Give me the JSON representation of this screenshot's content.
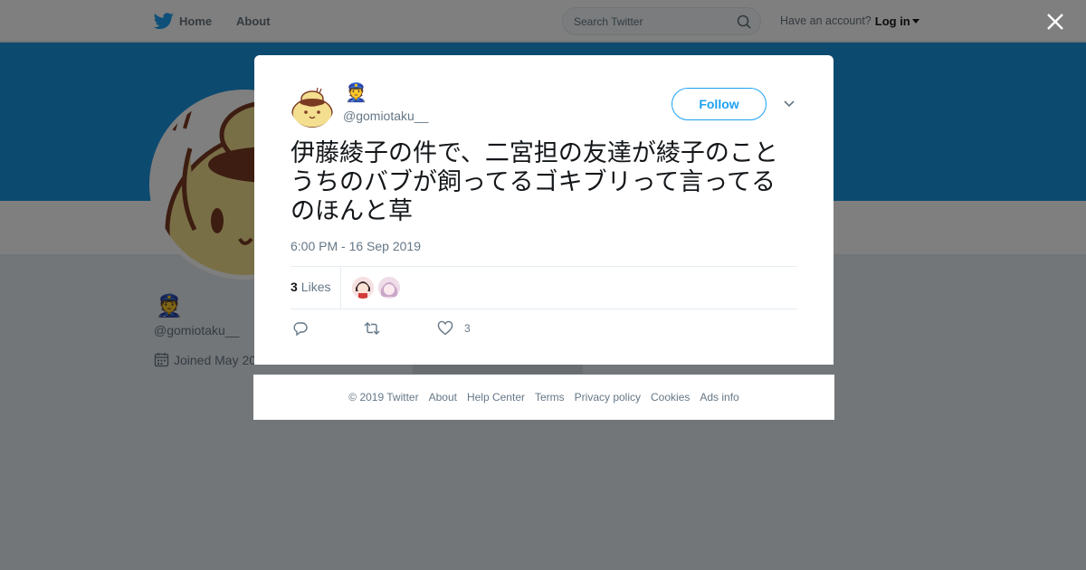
{
  "nav": {
    "home_label": "Home",
    "about_label": "About",
    "search_placeholder": "Search Twitter",
    "have_account": "Have an account?",
    "login_label": "Log in"
  },
  "profile": {
    "name_emoji": "👮",
    "handle": "@gomiotaku__",
    "joined": "Joined May 20"
  },
  "tweet": {
    "name_emoji": "👮",
    "handle": "@gomiotaku__",
    "follow_label": "Follow",
    "text": "伊藤綾子の件で、二宮担の友達が綾子のことうちのバブが飼ってるゴキブリって言ってるのほんと草",
    "timestamp": "6:00 PM - 16 Sep 2019",
    "likes_count": "3",
    "likes_label": "Likes",
    "like_action_count": "3"
  },
  "footer": {
    "links": [
      "© 2019 Twitter",
      "About",
      "Help Center",
      "Terms",
      "Privacy policy",
      "Cookies",
      "Ads info"
    ]
  },
  "colors": {
    "brand": "#1da1f2",
    "banner": "#1b95e0",
    "muted": "#657786"
  }
}
